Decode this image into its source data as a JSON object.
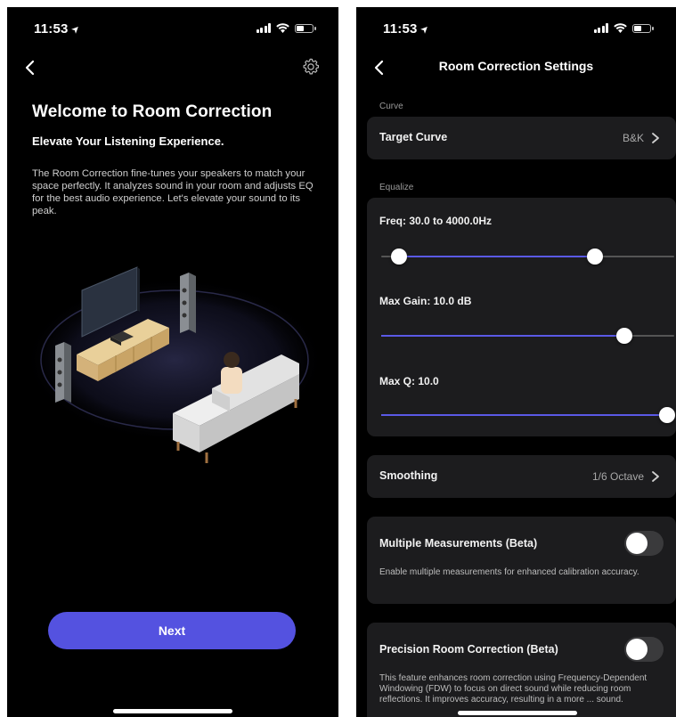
{
  "status_bar": {
    "time": "11:53",
    "location_arrow": "➤"
  },
  "welcome_screen": {
    "title": "Welcome to Room Correction",
    "subtitle": "Elevate Your Listening Experience.",
    "body": "The Room Correction fine-tunes your speakers to match your space perfectly. It analyzes sound in your room and adjusts EQ for the best audio experience. Let's elevate your sound to its peak.",
    "next_label": "Next",
    "icons": [
      "back-chevron-icon",
      "gear-icon"
    ]
  },
  "settings_screen": {
    "title": "Room Correction Settings",
    "curve_section": "Curve",
    "target_curve": {
      "label": "Target Curve",
      "value": "B&K"
    },
    "equalize_section": "Equalize",
    "freq": {
      "label": "Freq: 30.0 to 4000.0Hz",
      "low_fraction": 0.06,
      "high_fraction": 0.73
    },
    "max_gain": {
      "label": "Max Gain: 10.0 dB",
      "fraction": 0.83
    },
    "max_q": {
      "label": "Max Q: 10.0",
      "fraction": 1.0
    },
    "smoothing": {
      "label": "Smoothing",
      "value": "1/6 Octave"
    },
    "multiple_measurements": {
      "label": "Multiple Measurements (Beta)",
      "description": "Enable multiple measurements for enhanced calibration accuracy.",
      "enabled": false
    },
    "precision_room_correction": {
      "label": "Precision Room Correction (Beta)",
      "description": "This feature enhances room correction using Frequency-Dependent Windowing (FDW) to focus on direct sound while reducing room reflections. It improves accuracy, resulting in a more ... sound.",
      "enabled": false
    }
  },
  "colors": {
    "accent": "#5452e0",
    "background": "#000000",
    "card": "#1c1c1e"
  }
}
